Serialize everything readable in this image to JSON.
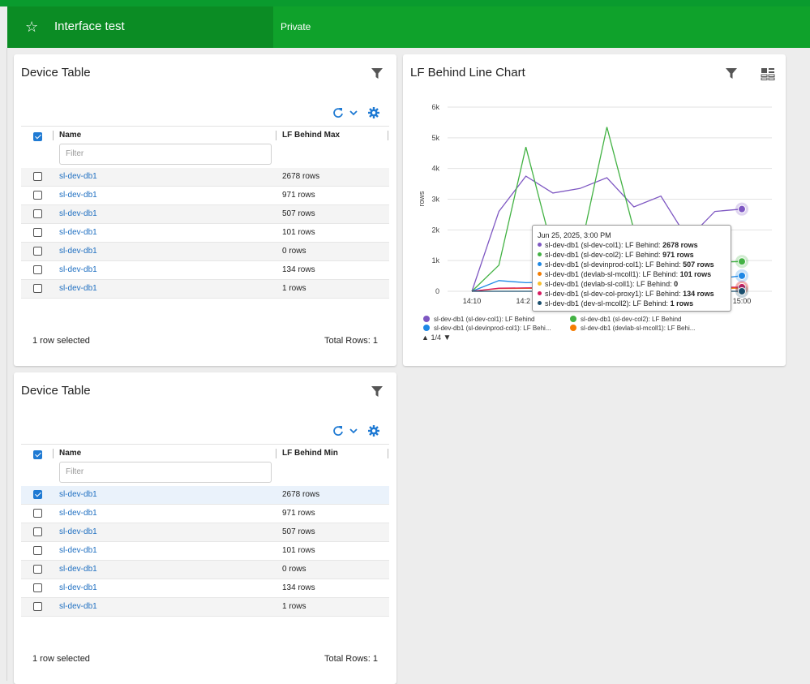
{
  "header": {
    "title": "Interface test",
    "visibility": "Private",
    "star_icon": "star-icon"
  },
  "table1": {
    "title": "Device Table",
    "col_name": "Name",
    "col_value": "LF Behind Max",
    "filter_placeholder": "Filter",
    "rows": [
      {
        "name": "sl-dev-db1",
        "value": "2678 rows"
      },
      {
        "name": "sl-dev-db1",
        "value": "971 rows"
      },
      {
        "name": "sl-dev-db1",
        "value": "507 rows"
      },
      {
        "name": "sl-dev-db1",
        "value": "101 rows"
      },
      {
        "name": "sl-dev-db1",
        "value": "0 rows"
      },
      {
        "name": "sl-dev-db1",
        "value": "134 rows"
      },
      {
        "name": "sl-dev-db1",
        "value": "1 rows"
      }
    ],
    "selected_text": "1 row selected",
    "total_text": "Total Rows: 1"
  },
  "table2": {
    "title": "Device Table",
    "col_name": "Name",
    "col_value": "LF Behind Min",
    "filter_placeholder": "Filter",
    "rows": [
      {
        "name": "sl-dev-db1",
        "value": "2678 rows"
      },
      {
        "name": "sl-dev-db1",
        "value": "971 rows"
      },
      {
        "name": "sl-dev-db1",
        "value": "507 rows"
      },
      {
        "name": "sl-dev-db1",
        "value": "101 rows"
      },
      {
        "name": "sl-dev-db1",
        "value": "0 rows"
      },
      {
        "name": "sl-dev-db1",
        "value": "134 rows"
      },
      {
        "name": "sl-dev-db1",
        "value": "1 rows"
      }
    ],
    "selected_text": "1 row selected",
    "total_text": "Total Rows: 1"
  },
  "chart_panel": {
    "title": "LF Behind Line Chart",
    "tooltip": {
      "date": "Jun 25, 2025, 3:00 PM",
      "lines": [
        {
          "label": "sl-dev-db1 (sl-dev-col1): LF Behind: ",
          "value": "2678 rows",
          "color": "#7e57c2"
        },
        {
          "label": "sl-dev-db1 (sl-dev-col2): LF Behind: ",
          "value": "971 rows",
          "color": "#43b244"
        },
        {
          "label": "sl-dev-db1 (sl-devinprod-col1): LF Behind: ",
          "value": "507 rows",
          "color": "#1e88e5"
        },
        {
          "label": "sl-dev-db1 (devlab-sl-mcoll1): LF Behind: ",
          "value": "101 rows",
          "color": "#f57c00"
        },
        {
          "label": "sl-dev-db1 (devlab-sl-coll1): LF Behind: ",
          "value": "0",
          "color": "#fbc02d"
        },
        {
          "label": "sl-dev-db1 (sl-dev-col-proxy1): LF Behind: ",
          "value": "134 rows",
          "color": "#d81b60"
        },
        {
          "label": "sl-dev-db1 (dev-sl-mcoll2): LF Behind: ",
          "value": "1 rows",
          "color": "#1a4f6e"
        }
      ]
    },
    "legend": [
      {
        "label": "sl-dev-db1 (sl-dev-col1): LF Behind",
        "color": "#7e57c2"
      },
      {
        "label": "sl-dev-db1 (sl-dev-col2): LF Behind",
        "color": "#43b244"
      },
      {
        "label": "sl-dev-db1 (sl-devinprod-col1): LF Behi...",
        "color": "#1e88e5"
      },
      {
        "label": "sl-dev-db1 (devlab-sl-mcoll1): LF Behi...",
        "color": "#f57c00"
      }
    ],
    "pager": "1/4"
  },
  "chart_data": {
    "type": "line",
    "ylabel": "rows",
    "ylim": [
      0,
      6000
    ],
    "y_ticks": [
      "0",
      "1k",
      "2k",
      "3k",
      "4k",
      "5k",
      "6k"
    ],
    "x_ticks": [
      "14:10",
      "14:2",
      "15:00"
    ],
    "grid": true,
    "series": [
      {
        "name": "sl-dev-db1 (sl-dev-col1): LF Behind",
        "color": "#7e57c2",
        "points": [
          [
            0,
            0
          ],
          [
            1,
            2600
          ],
          [
            2,
            3750
          ],
          [
            3,
            3200
          ],
          [
            4,
            3350
          ],
          [
            5,
            3700
          ],
          [
            6,
            2750
          ],
          [
            7,
            3100
          ],
          [
            8,
            1700
          ],
          [
            9,
            2600
          ],
          [
            10,
            2678
          ]
        ]
      },
      {
        "name": "sl-dev-db1 (sl-dev-col2): LF Behind",
        "color": "#43b244",
        "points": [
          [
            0,
            0
          ],
          [
            1,
            850
          ],
          [
            2,
            4700
          ],
          [
            3,
            1300
          ],
          [
            4,
            1250
          ],
          [
            5,
            5350
          ],
          [
            6,
            2000
          ],
          [
            7,
            900
          ],
          [
            8,
            900
          ],
          [
            9,
            950
          ],
          [
            10,
            971
          ]
        ]
      },
      {
        "name": "sl-dev-db1 (sl-devinprod-col1): LF Behind",
        "color": "#1e88e5",
        "points": [
          [
            0,
            0
          ],
          [
            1,
            350
          ],
          [
            2,
            280
          ],
          [
            3,
            300
          ],
          [
            4,
            320
          ],
          [
            5,
            330
          ],
          [
            6,
            340
          ],
          [
            7,
            350
          ],
          [
            8,
            360
          ],
          [
            9,
            400
          ],
          [
            10,
            507
          ]
        ]
      },
      {
        "name": "sl-dev-db1 (devlab-sl-mcoll1): LF Behind",
        "color": "#f57c00",
        "points": [
          [
            0,
            0
          ],
          [
            1,
            90
          ],
          [
            2,
            95
          ],
          [
            3,
            100
          ],
          [
            4,
            100
          ],
          [
            5,
            100
          ],
          [
            6,
            100
          ],
          [
            7,
            100
          ],
          [
            8,
            100
          ],
          [
            9,
            100
          ],
          [
            10,
            101
          ]
        ]
      },
      {
        "name": "sl-dev-db1 (sl-dev-col-proxy1): LF Behind",
        "color": "#d81b60",
        "points": [
          [
            0,
            0
          ],
          [
            1,
            100
          ],
          [
            2,
            110
          ],
          [
            3,
            120
          ],
          [
            4,
            120
          ],
          [
            5,
            120
          ],
          [
            6,
            125
          ],
          [
            7,
            130
          ],
          [
            8,
            130
          ],
          [
            9,
            130
          ],
          [
            10,
            134
          ]
        ]
      },
      {
        "name": "sl-dev-db1 (dev-sl-mcoll2): LF Behind",
        "color": "#1a4f6e",
        "points": [
          [
            0,
            0
          ],
          [
            1,
            1
          ],
          [
            2,
            1
          ],
          [
            3,
            1
          ],
          [
            4,
            1
          ],
          [
            5,
            1
          ],
          [
            6,
            1
          ],
          [
            7,
            1
          ],
          [
            8,
            1
          ],
          [
            9,
            1
          ],
          [
            10,
            1
          ]
        ]
      }
    ]
  }
}
